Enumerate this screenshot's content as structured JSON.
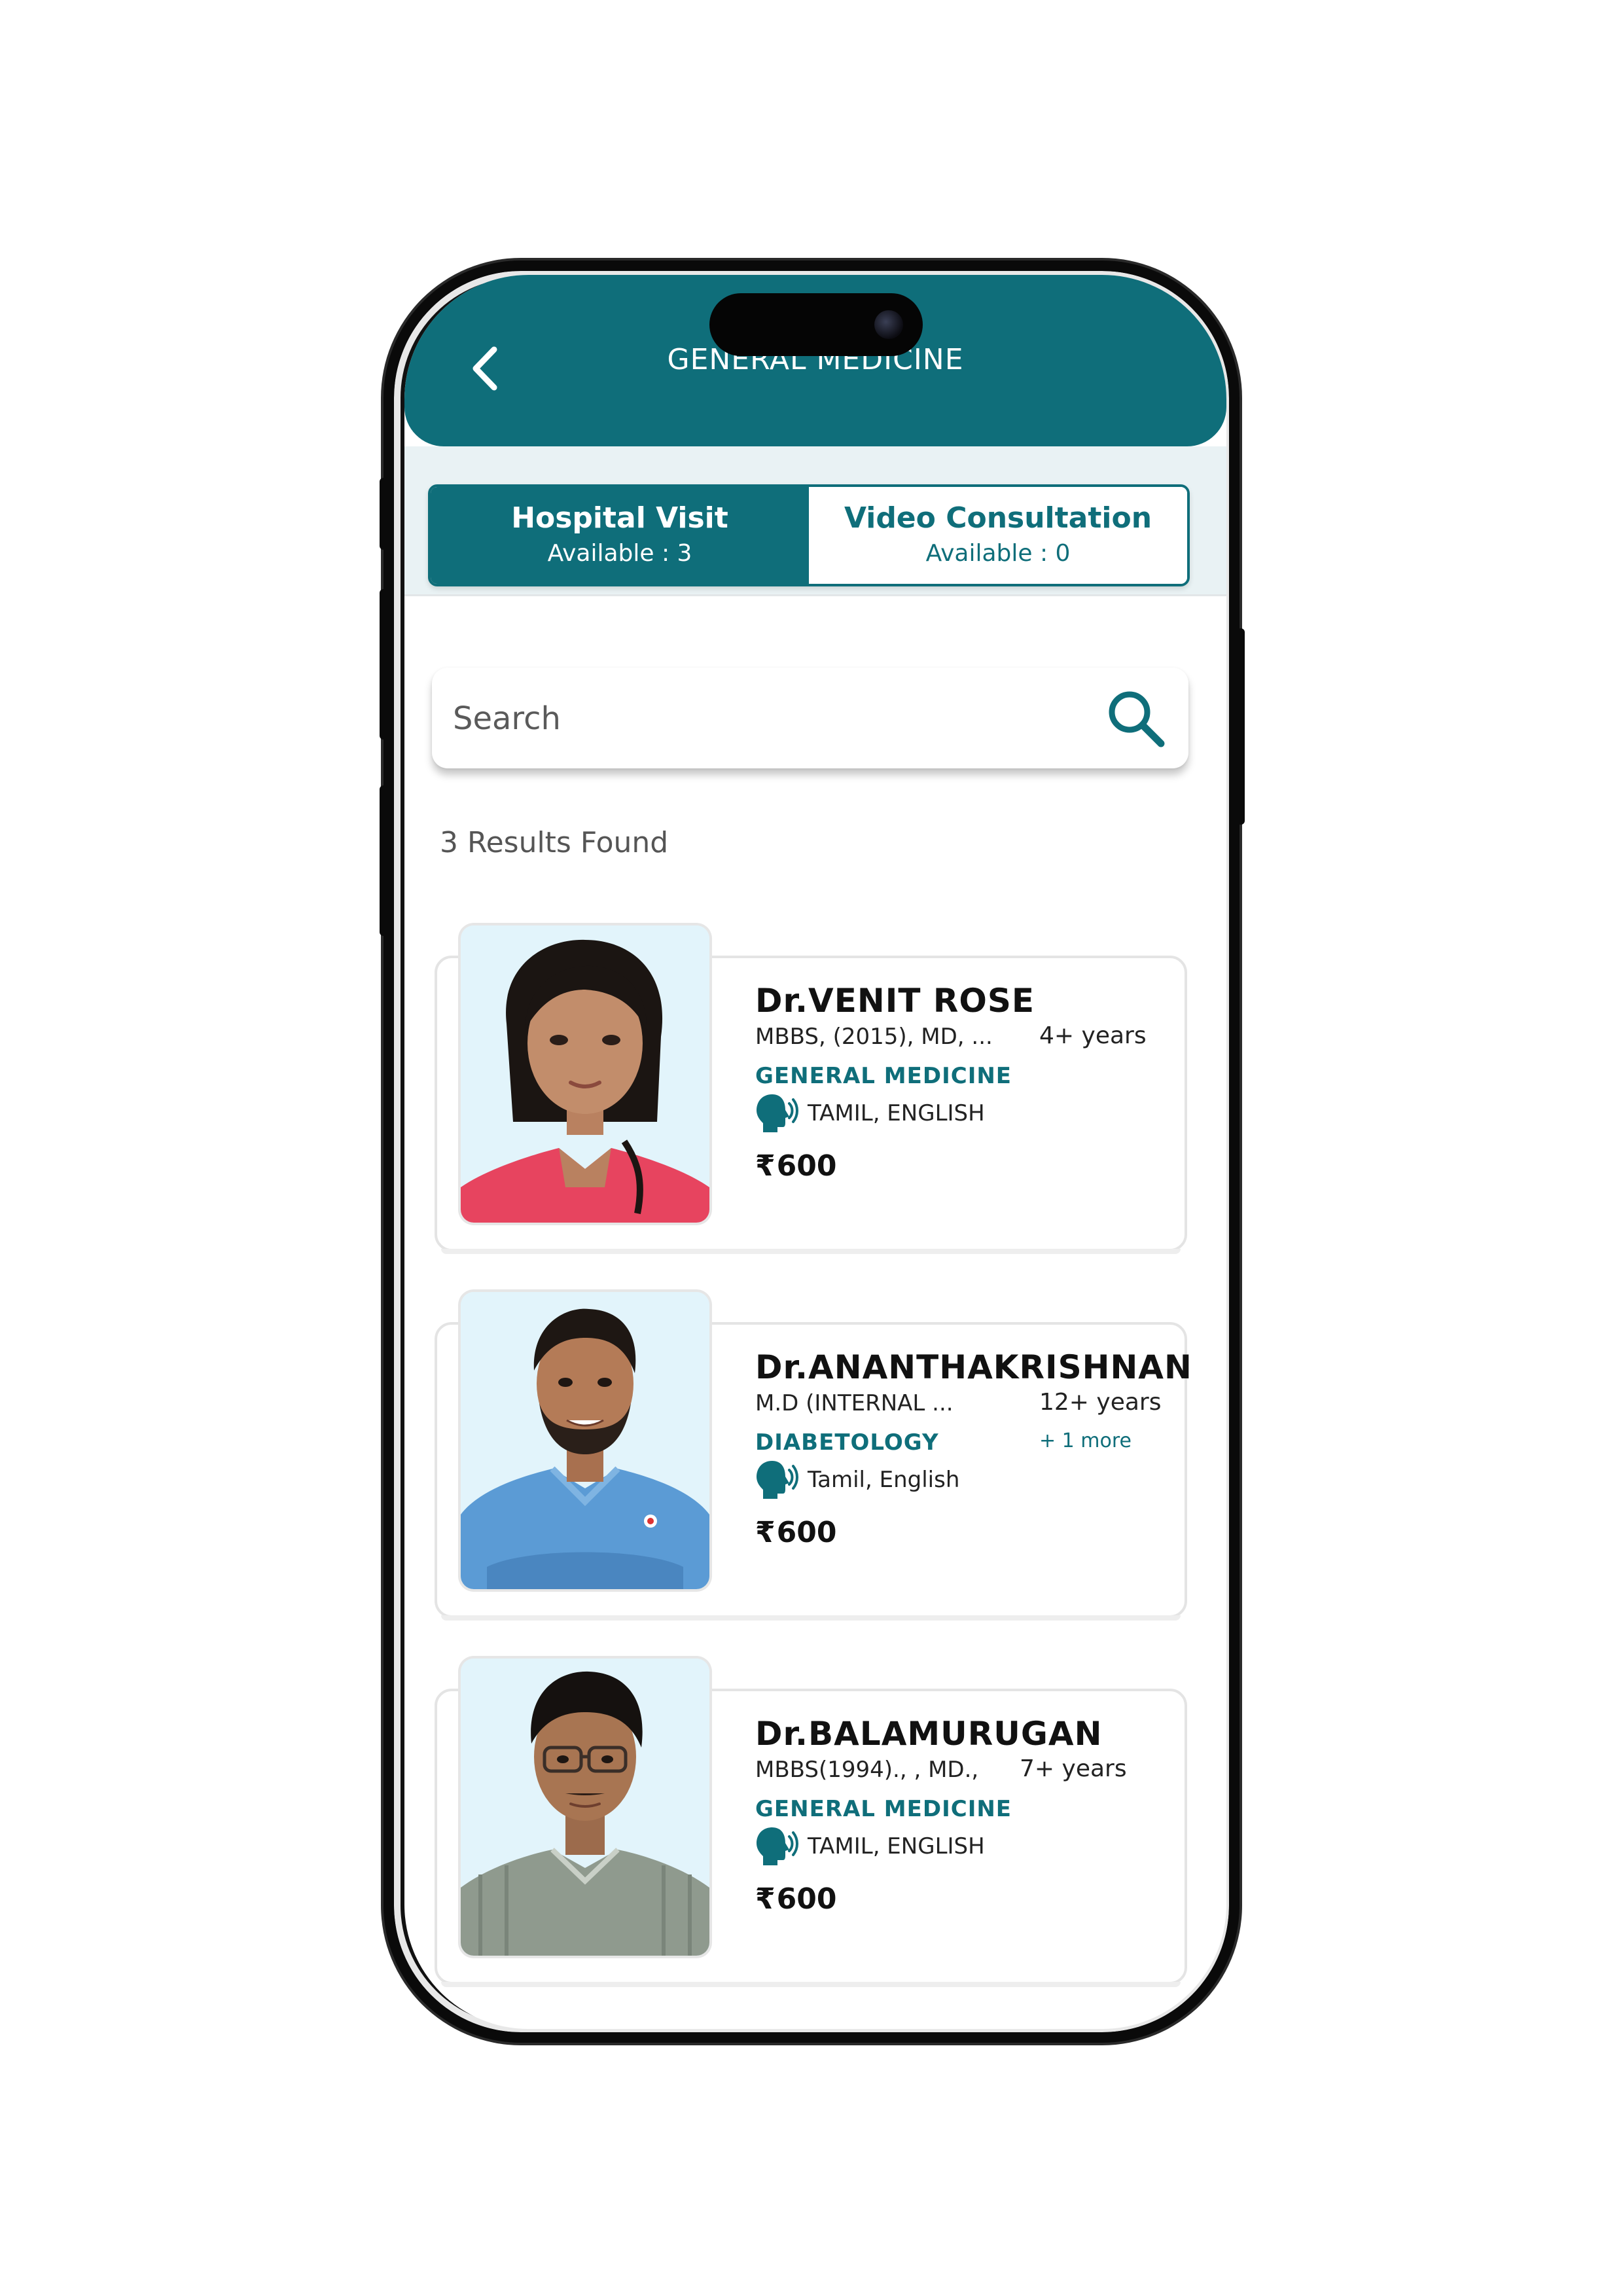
{
  "header": {
    "title": "GENERAL MEDICINE"
  },
  "tabs": [
    {
      "label": "Hospital Visit",
      "sub": "Available : 3",
      "active": true
    },
    {
      "label": "Video Consultation",
      "sub": "Available : 0",
      "active": false
    }
  ],
  "search": {
    "placeholder": "Search"
  },
  "results": {
    "count_text": "3  Results Found"
  },
  "doctors": [
    {
      "name": "Dr.VENIT ROSE",
      "qualification": "MBBS, (2015), MD, ...",
      "experience": "4+ years",
      "specialty": "GENERAL MEDICINE",
      "more": "",
      "languages": "TAMIL, ENGLISH",
      "currency": "₹",
      "fee": "600"
    },
    {
      "name": "Dr.ANANTHAKRISHNAN",
      "qualification": "M.D (INTERNAL ...",
      "experience": "12+ years",
      "specialty": "DIABETOLOGY",
      "more": "+ 1 more",
      "languages": "Tamil, English",
      "currency": "₹",
      "fee": "600"
    },
    {
      "name": "Dr.BALAMURUGAN",
      "qualification": "MBBS(1994)., , MD.,",
      "experience": "7+ years",
      "specialty": "GENERAL MEDICINE",
      "more": "",
      "languages": "TAMIL, ENGLISH",
      "currency": "₹",
      "fee": "600"
    }
  ],
  "colors": {
    "primary": "#0f6e7a",
    "tab_strip": "#e9f2f4",
    "photo_bg": "#e2f4fb"
  },
  "icons": {
    "back": "chevron-left-icon",
    "search": "search-icon",
    "language": "speaking-head-icon"
  }
}
